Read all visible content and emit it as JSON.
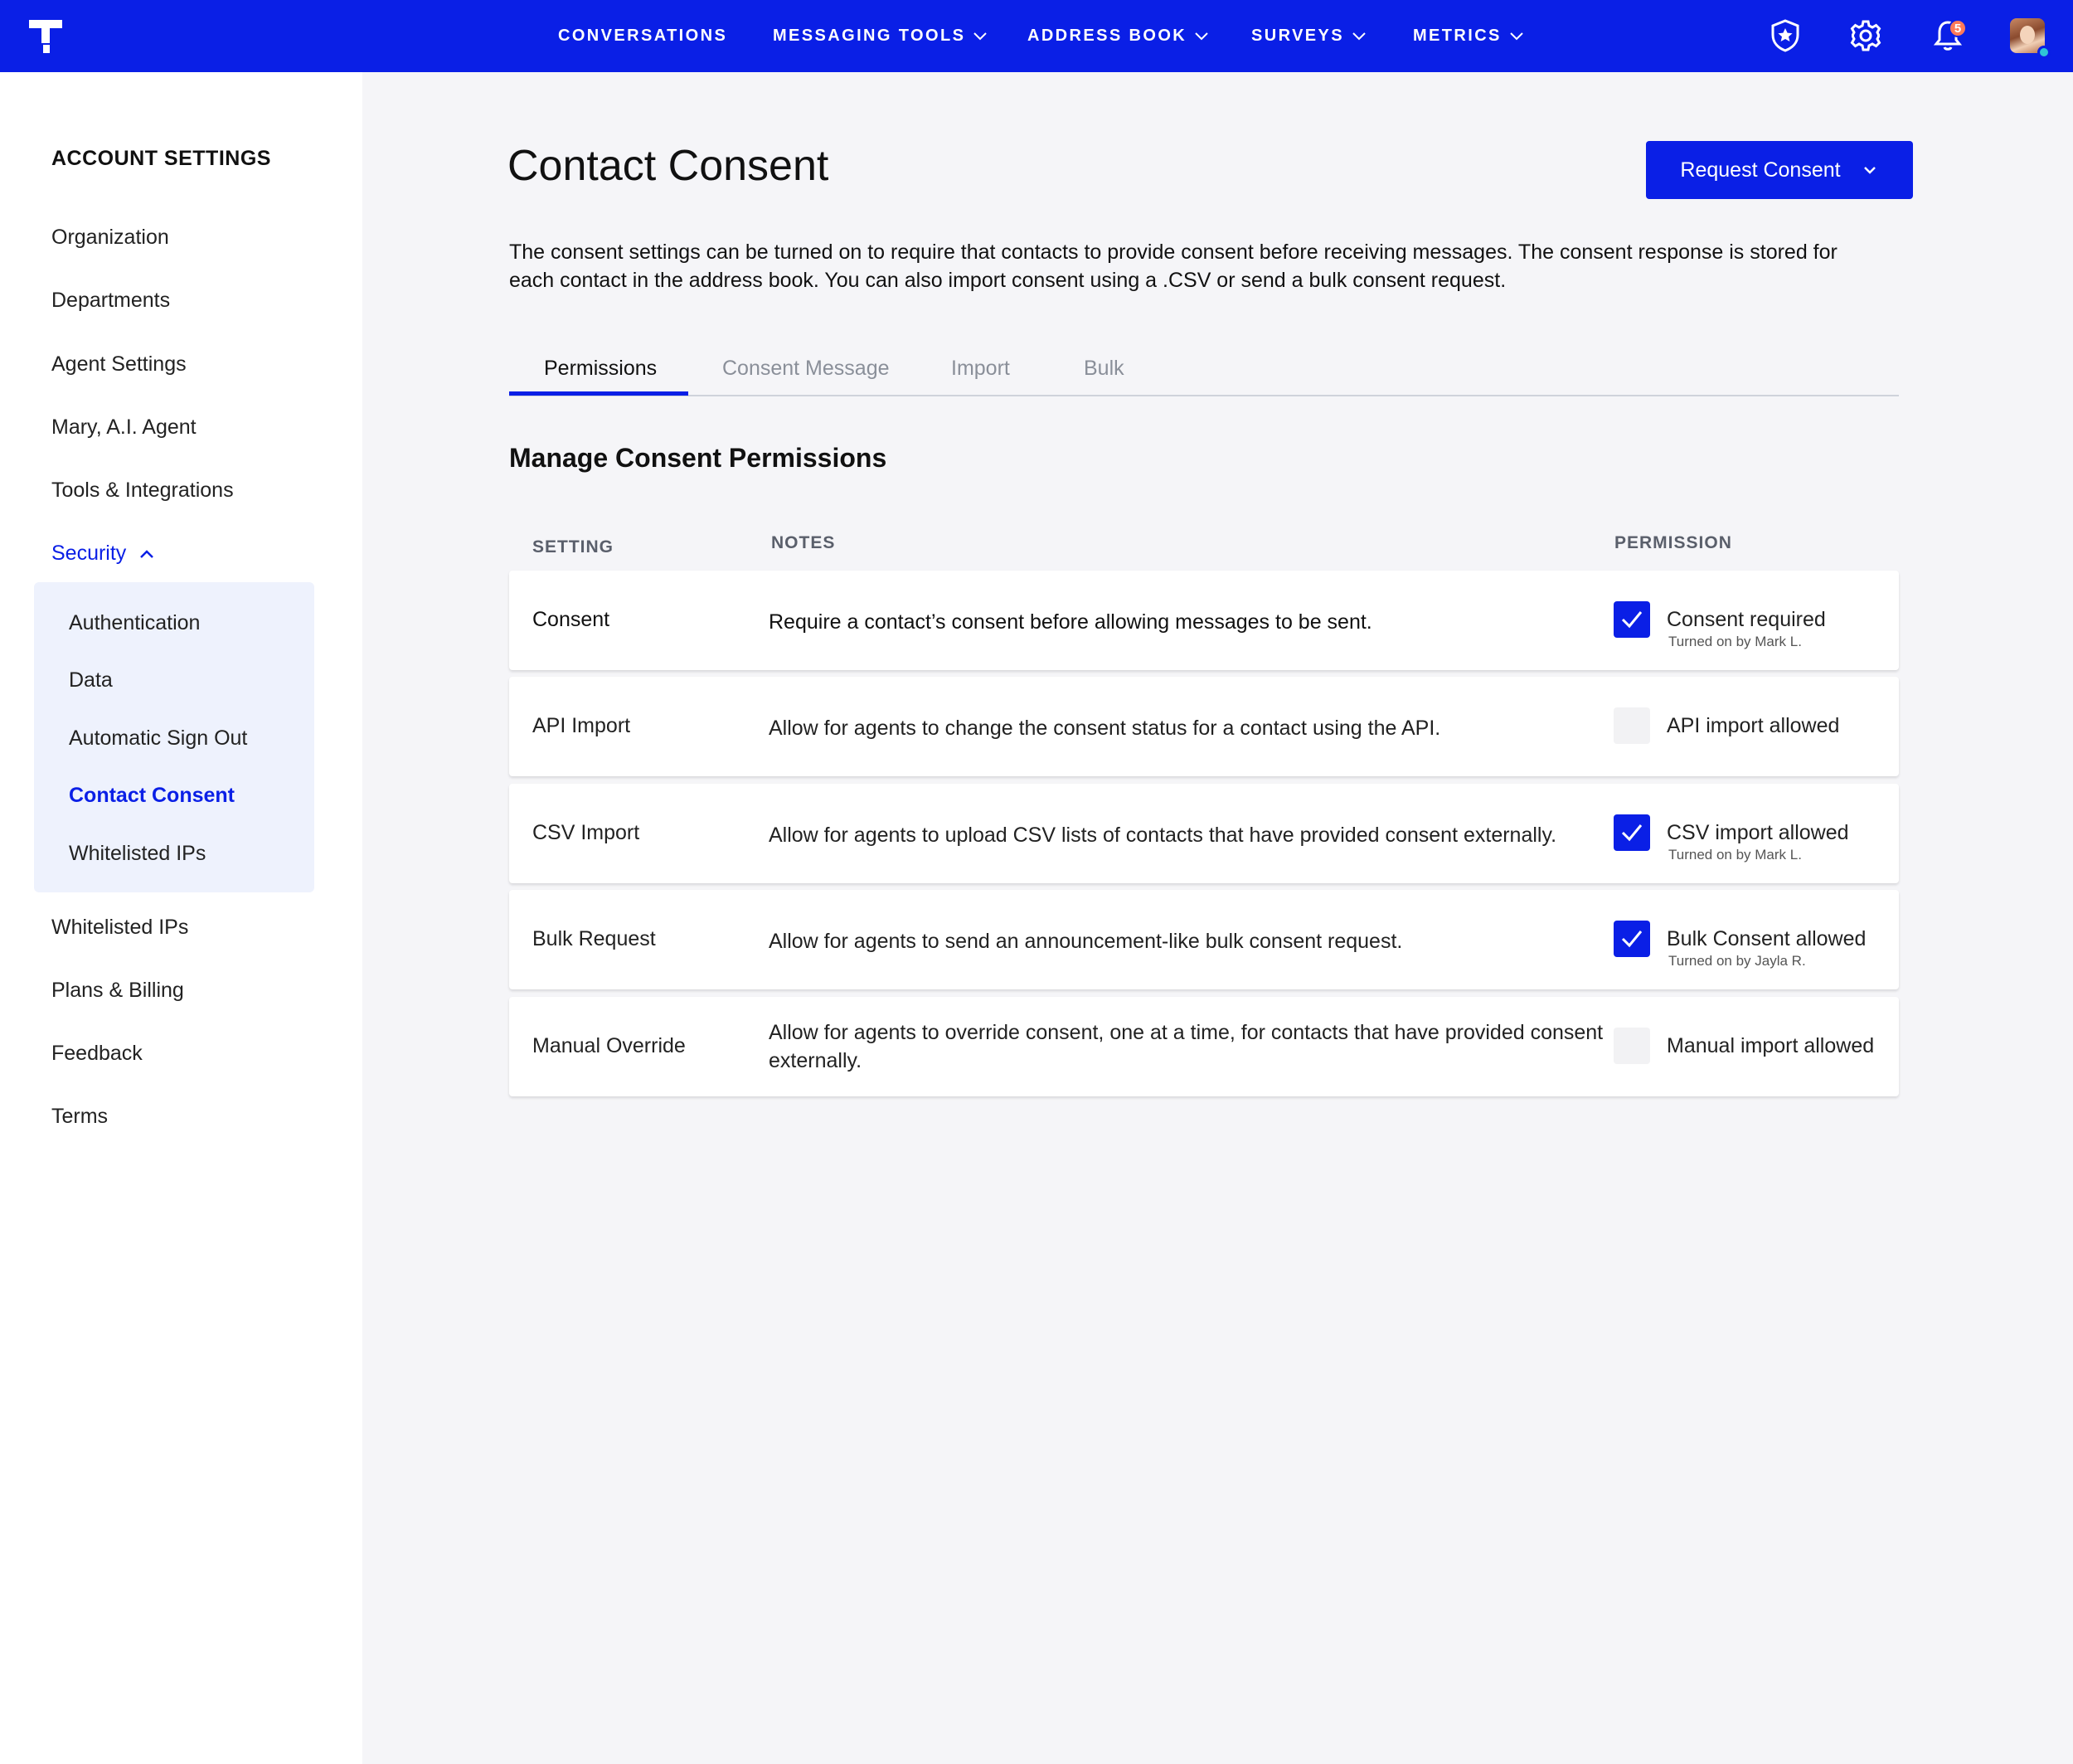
{
  "topbar": {
    "nav": [
      {
        "label": "CONVERSATIONS",
        "has_dropdown": false
      },
      {
        "label": "MESSAGING TOOLS",
        "has_dropdown": true
      },
      {
        "label": "ADDRESS BOOK",
        "has_dropdown": true
      },
      {
        "label": "SURVEYS",
        "has_dropdown": true
      },
      {
        "label": "METRICS",
        "has_dropdown": true
      }
    ],
    "notification_count": "5",
    "icons": [
      "logo-icon",
      "star-shield-icon",
      "gear-icon",
      "bell-icon",
      "avatar"
    ]
  },
  "sidebar": {
    "title": "ACCOUNT SETTINGS",
    "items": [
      "Organization",
      "Departments",
      "Agent Settings",
      "Mary, A.I. Agent",
      "Tools & Integrations"
    ],
    "security_label": "Security",
    "security_sub": [
      "Authentication",
      "Data",
      "Automatic Sign Out",
      "Contact Consent",
      "Whitelisted IPs"
    ],
    "items_after": [
      "Whitelisted IPs",
      "Plans & Billing",
      "Feedback",
      "Terms"
    ]
  },
  "main": {
    "title": "Contact Consent",
    "request_button": "Request Consent",
    "description": "The consent settings can be turned on to require that contacts to provide consent before receiving messages. The consent response is stored for each contact in the address book. You can also import consent using a .CSV or send a bulk consent request.",
    "tabs": [
      "Permissions",
      "Consent Message",
      "Import",
      "Bulk"
    ],
    "active_tab": "Permissions",
    "section_title": "Manage Consent Permissions",
    "columns": {
      "setting": "SETTING",
      "notes": "NOTES",
      "permission": "PERMISSION"
    },
    "rows": [
      {
        "setting": "Consent",
        "notes": "Require a contact’s consent before allowing messages to be sent.",
        "permission": "Consent required",
        "checked": true,
        "sub": "Turned on by Mark L."
      },
      {
        "setting": "API Import",
        "notes": "Allow for agents to change the consent status for a contact using the API.",
        "permission": "API import allowed",
        "checked": false,
        "sub": ""
      },
      {
        "setting": "CSV Import",
        "notes": "Allow for agents to upload CSV lists of contacts that have provided consent externally.",
        "permission": "CSV import allowed",
        "checked": true,
        "sub": "Turned on by Mark L."
      },
      {
        "setting": "Bulk Request",
        "notes": "Allow for agents to send an announcement-like bulk consent request.",
        "permission": "Bulk Consent allowed",
        "checked": true,
        "sub": "Turned on by Jayla R."
      },
      {
        "setting": "Manual Override",
        "notes": "Allow for agents to override consent, one at a time, for contacts that have provided consent externally.",
        "permission": "Manual import allowed",
        "checked": false,
        "sub": ""
      }
    ]
  },
  "colors": {
    "brand": "#0a1fe6",
    "page_bg": "#f5f5f8",
    "sub_nav_bg": "#eef2fd",
    "badge": "#ff7a59",
    "presence": "#2ec4d6"
  }
}
